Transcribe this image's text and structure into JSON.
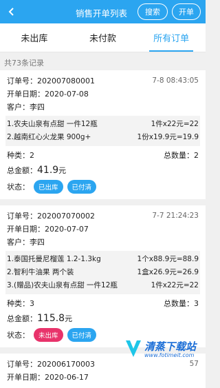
{
  "header": {
    "title": "销售开单列表",
    "search_label": "搜索",
    "create_label": "开单"
  },
  "tabs": [
    {
      "label": "未出库"
    },
    {
      "label": "未付款"
    },
    {
      "label": "所有订单"
    }
  ],
  "list": {
    "count_text": "共73条记录"
  },
  "orders": [
    {
      "order_no": "订单号：202007080001",
      "time": "7-8 08:43:05",
      "date": "开单日期：2020-07-08",
      "customer": "客户：李四",
      "items": [
        {
          "name": "1.农夫山泉有点甜 一件12瓶",
          "qty": "1件x22元=22"
        },
        {
          "name": "2.越南红心火龙果 900g+",
          "qty": "1份x19.9元=19.9"
        }
      ],
      "kinds": "种类：2",
      "total_qty": "总数量：2",
      "amount_label": "总金额：",
      "amount_value": "41.9",
      "amount_unit": "元",
      "status_label": "状态：",
      "badge1": "已出库",
      "badge2": "已付清"
    },
    {
      "order_no": "订单号：202007070002",
      "time": "7-7 21:24:23",
      "date": "开单日期：2020-07-07",
      "customer": "客户：李四",
      "items": [
        {
          "name": "1.泰国托曼尼榴莲 1.2-1.3kg",
          "qty": "1个x88.9元=88.9"
        },
        {
          "name": "2.智利牛油果 两个装",
          "qty": "1盒x26.9元=26.9"
        },
        {
          "name": "3.(赠品)农夫山泉有点甜 一件12瓶",
          "qty": "1件x22元=22"
        }
      ],
      "kinds": "种类：3",
      "total_qty": "总数量：3",
      "amount_label": "总金额：",
      "amount_value": "115.8",
      "amount_unit": "元",
      "status_label": "状态：",
      "badge1": "未出库",
      "badge2": "已付清"
    },
    {
      "order_no": "订单号：202006170003",
      "time": "57",
      "date": "开单日期：2020-06-17"
    }
  ],
  "watermark": {
    "text": "清蒸下载站",
    "url": "www.fotimeit.com"
  },
  "colors": {
    "primary": "#2ba5f0",
    "badge_shipped": "#2ba5f0",
    "badge_unshipped": "#e8336b",
    "badge_paid": "#2ba5f0"
  }
}
